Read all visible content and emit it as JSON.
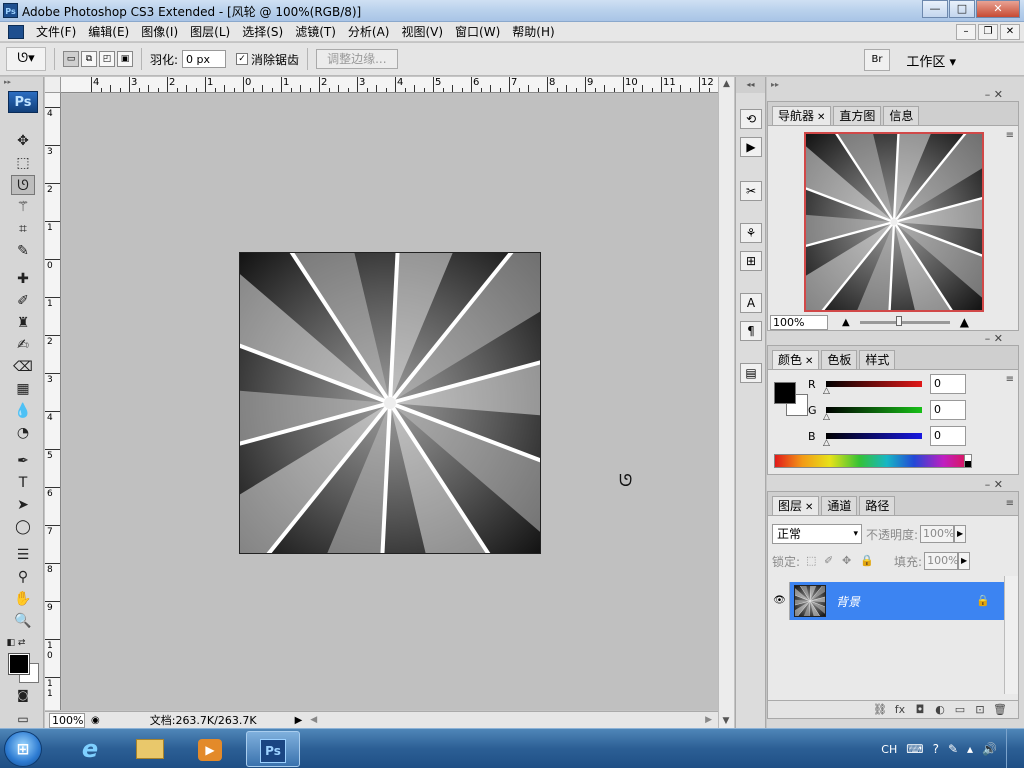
{
  "window": {
    "title": "Adobe Photoshop CS3 Extended - [风轮 @ 100%(RGB/8)]",
    "min": "—",
    "max": "□",
    "close": "✕",
    "app_icon": "Ps"
  },
  "menu": {
    "items": [
      "文件(F)",
      "编辑(E)",
      "图像(I)",
      "图层(L)",
      "选择(S)",
      "滤镜(T)",
      "分析(A)",
      "视图(V)",
      "窗口(W)",
      "帮助(H)"
    ],
    "doc_min": "–",
    "doc_restore": "❐",
    "doc_close": "✕"
  },
  "options": {
    "feather_label": "羽化:",
    "feather_value": "0 px",
    "antialias_label": "消除锯齿",
    "antialias_checked": "✓",
    "refine_edge": "调整边缘...",
    "workspace": "工作区 ▾",
    "bridge_icon": "Br"
  },
  "toolbox": {
    "logo": "Ps",
    "tools": [
      "move-tool",
      "marquee-tool",
      "lasso-tool",
      "magic-wand-tool",
      "crop-tool",
      "eyedropper-slice-tool",
      "healing-brush-tool",
      "brush-tool",
      "clone-stamp-tool",
      "history-brush-tool",
      "eraser-tool",
      "gradient-tool",
      "blur-tool",
      "dodge-tool",
      "pen-tool",
      "type-tool",
      "path-selection-tool",
      "shape-tool",
      "notes-tool",
      "eyedropper-tool",
      "hand-tool",
      "zoom-tool"
    ],
    "foreground": "#000000",
    "background": "#ffffff"
  },
  "rulers": {
    "top": [
      "4",
      "3",
      "2",
      "1",
      "0",
      "1",
      "2",
      "3",
      "4",
      "5",
      "6",
      "7",
      "8",
      "9",
      "10",
      "11",
      "12"
    ],
    "left": [
      "4",
      "3",
      "2",
      "1",
      "0",
      "1",
      "2",
      "3",
      "4",
      "5",
      "6",
      "7",
      "8",
      "9",
      "1 0",
      "1 1"
    ]
  },
  "status": {
    "zoom": "100%",
    "doc_size": "文档:263.7K/263.7K"
  },
  "navigator": {
    "tabs": [
      "导航器",
      "直方图",
      "信息"
    ],
    "zoom": "100%"
  },
  "color": {
    "tabs": [
      "颜色",
      "色板",
      "样式"
    ],
    "channels": [
      {
        "label": "R",
        "value": "0",
        "color": "#d01818"
      },
      {
        "label": "G",
        "value": "0",
        "color": "#18b018"
      },
      {
        "label": "B",
        "value": "0",
        "color": "#1818d0"
      }
    ]
  },
  "layers": {
    "tabs": [
      "图层",
      "通道",
      "路径"
    ],
    "blend_mode": "正常",
    "opacity_label": "不透明度:",
    "opacity": "100%",
    "lock_label": "锁定:",
    "fill_label": "填充:",
    "fill": "100%",
    "layer_name": "背景",
    "selected_color": "#3c84f2"
  },
  "taskbar": {
    "tray_lang": "CH",
    "ps_label": "Ps"
  }
}
